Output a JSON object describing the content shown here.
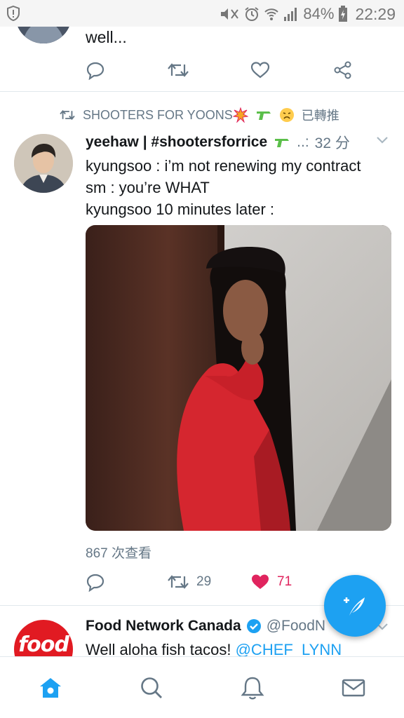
{
  "status_bar": {
    "battery": "84%",
    "time": "22:29"
  },
  "previous_tweet": {
    "text": "well..."
  },
  "retweet_header": {
    "text": "SHOOTERS FOR YOONS",
    "suffix": "已轉推"
  },
  "tweet": {
    "display_name": "yeehaw | #shootersforrice",
    "handle_truncated": "..:",
    "time": "32 分",
    "lines": [
      "kyungsoo : i’m not renewing my contract",
      "sm : you’re WHAT",
      "kyungsoo 10 minutes later :"
    ],
    "views": "867 次查看",
    "retweet_count": "29",
    "like_count": "71"
  },
  "next_tweet": {
    "display_name": "Food Network Canada",
    "handle": "@FoodN",
    "text_plain": "Well aloha fish tacos! ",
    "mention": "@CHEF_LYNN",
    "avatar_text": "food"
  },
  "colors": {
    "accent": "#1da1f2",
    "like": "#e0245e",
    "secondary_text": "#657786"
  },
  "icons": {
    "tabs": [
      "home-icon",
      "search-icon",
      "notifications-icon",
      "messages-icon"
    ],
    "fab": "compose-tweet-icon"
  }
}
